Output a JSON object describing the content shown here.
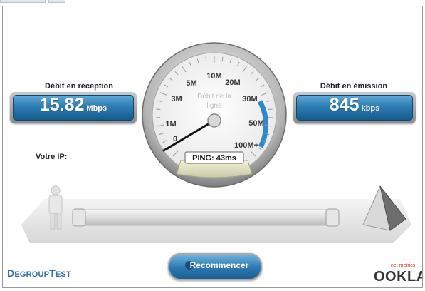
{
  "download": {
    "title": "Débit en réception",
    "value": "15.82",
    "unit": "Mbps"
  },
  "upload": {
    "title": "Débit en émission",
    "value": "845",
    "unit": "kbps"
  },
  "ip": {
    "label": "Votre IP:"
  },
  "gauge": {
    "center_text_line1": "Débit de la",
    "center_text_line2": "ligne",
    "scale_labels": [
      "0",
      "1M",
      "3M",
      "5M",
      "10M",
      "20M",
      "30M",
      "50M",
      "100M+"
    ],
    "ping_label": "PING: 43ms"
  },
  "buttons": {
    "restart": "Recommencer"
  },
  "branding": {
    "left_part1": "D",
    "left_part2": "EGROUP",
    "left_part3": "T",
    "left_part4": "EST",
    "netmetrics": "net metrics",
    "ookla": "OOKLA"
  },
  "colors": {
    "accent": "#2c7db4",
    "brand_blue": "#2f6fa8",
    "ookla_red": "#c0392b"
  }
}
